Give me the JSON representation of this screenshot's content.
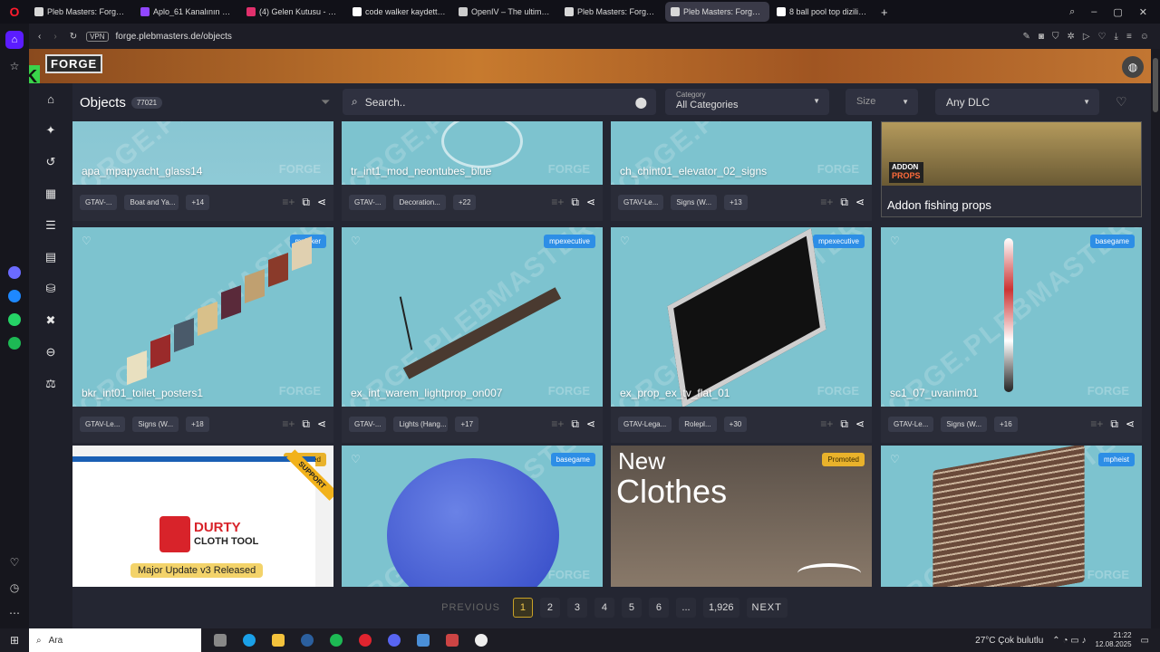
{
  "browser": {
    "tabs": [
      {
        "title": "Pleb Masters: Forge - GTA",
        "color": "#d8d8d8",
        "active": false
      },
      {
        "title": "Aplo_61 Kanalının Videolu",
        "color": "#9146ff",
        "active": false
      },
      {
        "title": "(4) Gelen Kutusu - Sohbet",
        "color": "#e1306c",
        "active": false
      },
      {
        "title": "code walker kaydettiğimiz",
        "color": "#ffffff",
        "active": false
      },
      {
        "title": "OpenIV – The ultimate mo",
        "color": "#cccccc",
        "active": false
      },
      {
        "title": "Pleb Masters: Forge - GTA",
        "color": "#d8d8d8",
        "active": false
      },
      {
        "title": "Pleb Masters: Forge - GTA",
        "color": "#d8d8d8",
        "active": true
      },
      {
        "title": "8 ball pool top dizilimi - G",
        "color": "#ffffff",
        "active": false
      }
    ],
    "new_tab": "+",
    "url": "forge.plebmasters.de/objects",
    "vpn_label": "VPN"
  },
  "header": {
    "logo_k": "K",
    "logo_text": "FORGE"
  },
  "filters": {
    "title": "Objects",
    "count": "77021",
    "search_placeholder": "Search..",
    "category_label": "Category",
    "category_value": "All Categories",
    "size_label": "Size",
    "dlc_value": "Any DLC"
  },
  "watermark": "FORGE.PLEBMASTERS",
  "forge_mark": "FORGE",
  "addon": {
    "tag_line1": "ADDON",
    "tag_line2": "PROPS",
    "name": "Addon fishing props"
  },
  "cards_row1": [
    {
      "name": "apa_mpapyacht_glass14",
      "tag1": "GTAV-...",
      "tag2": "Boat and Ya...",
      "more": "+14"
    },
    {
      "name": "tr_int1_mod_neontubes_blue",
      "tag1": "GTAV-...",
      "tag2": "Decoration...",
      "more": "+22"
    },
    {
      "name": "ch_chint01_elevator_02_signs",
      "tag1": "GTAV-Le...",
      "tag2": "Signs (W...",
      "more": "+13"
    }
  ],
  "cards_row2": [
    {
      "name": "bkr_int01_toilet_posters1",
      "badge": "mpbiker",
      "tag1": "GTAV-Le...",
      "tag2": "Signs (W...",
      "more": "+18"
    },
    {
      "name": "ex_int_warem_lightprop_on007",
      "badge": "mpexecutive",
      "tag1": "GTAV-...",
      "tag2": "Lights (Hang...",
      "more": "+17"
    },
    {
      "name": "ex_prop_ex_tv_flat_01",
      "badge": "mpexecutive",
      "tag1": "GTAV-Lega...",
      "tag2": "Rolepl...",
      "more": "+30"
    },
    {
      "name": "sc1_07_uvanim01",
      "badge": "basegame",
      "tag1": "GTAV-Le...",
      "tag2": "Signs (W...",
      "more": "+16"
    }
  ],
  "cards_row3": [
    {
      "badge": "Promoted",
      "caption": "Major Update v3 Released",
      "promo_title1": "DURTY",
      "promo_title2": "CLOTH TOOL",
      "ribbon": "SUPPORT"
    },
    {
      "badge": "basegame"
    },
    {
      "badge": "Promoted",
      "big1": "New",
      "big2": "Clothes"
    },
    {
      "badge": "mpheist"
    }
  ],
  "pagination": {
    "prev": "PREVIOUS",
    "pages": [
      "1",
      "2",
      "3",
      "4",
      "5",
      "6",
      "...",
      "1,926"
    ],
    "current": "1",
    "next": "NEXT"
  },
  "taskbar": {
    "search": "Ara",
    "weather": "27°C  Çok bulutlu",
    "time": "21:22",
    "date": "12.08.2025"
  },
  "colors": {
    "card_bg": "#7dc3cf",
    "badge_blue": "#2d8ee6",
    "badge_promo": "#e9b22b",
    "page_bg": "#242632"
  }
}
